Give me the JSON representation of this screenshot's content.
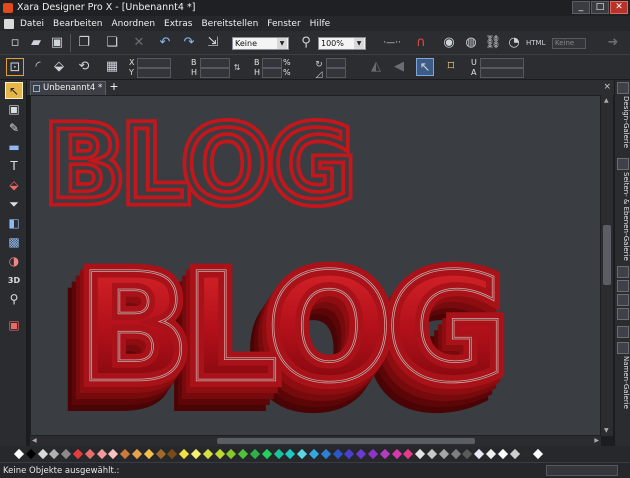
{
  "window": {
    "title": "Xara Designer Pro X - [Unbenannt4 *]",
    "buttons": [
      "_",
      "□",
      "✕"
    ]
  },
  "menu": {
    "items": [
      "Datei",
      "Bearbeiten",
      "Anordnen",
      "Extras",
      "Bereitstellen",
      "Fenster",
      "Hilfe"
    ]
  },
  "toolbar": {
    "quality_select": "Keine",
    "zoom_select": "100%",
    "name_field_placeholder": "Keine"
  },
  "infobar": {
    "labels": {
      "x": "X",
      "y": "Y",
      "b": "B",
      "h": "H",
      "b2": "B",
      "h2": "H",
      "unit_pct_1": "%",
      "unit_pct_2": "%",
      "u": "U",
      "a": "A"
    }
  },
  "tabs": {
    "active_doc": "Unbenannt4 *",
    "add": "+",
    "close": "×"
  },
  "canvas": {
    "heading_flat": "BLOG",
    "heading_3d": "BLOG",
    "colors": {
      "background": "#3a3d42",
      "outline": "#c4171c",
      "extrude_dark": "#5c0608",
      "extrude_mid": "#8e0d10",
      "highlight": "#f2b8b8"
    }
  },
  "right_galleries": [
    "Design-Galerie",
    "Seiten- & Ebenen-Galerie",
    "Namen-Galerie"
  ],
  "status": {
    "message": "Keine Objekte ausgewählt.:"
  },
  "palette": {
    "colors": [
      "#ffffff",
      "#000000",
      "#d9d9d9",
      "#b0b0b0",
      "#8a8a8a",
      "#e63c3c",
      "#e86e6e",
      "#f29a9a",
      "#f7c2c2",
      "#c97a3c",
      "#e8a24a",
      "#f5c04a",
      "#a06a2a",
      "#7a4a1a",
      "#f0e040",
      "#f7f070",
      "#d6e040",
      "#c0d830",
      "#8ac62e",
      "#4fc23a",
      "#2fb04a",
      "#22d060",
      "#19c49a",
      "#1fc9c4",
      "#5ad6e6",
      "#33a9e0",
      "#2b7fd6",
      "#2f56c8",
      "#4a3fd0",
      "#6b3ad0",
      "#8e35c8",
      "#b33cbf",
      "#d43aa9",
      "#e83a88",
      "#e6e6e6",
      "#c8c8c8",
      "#a6a6a6",
      "#7e7e7e",
      "#5a5a5a",
      "#e8e8f8",
      "#f0f0f0",
      "#ffffff",
      "#cfcfcf",
      "#2a2a2a",
      "#ffffff"
    ]
  }
}
